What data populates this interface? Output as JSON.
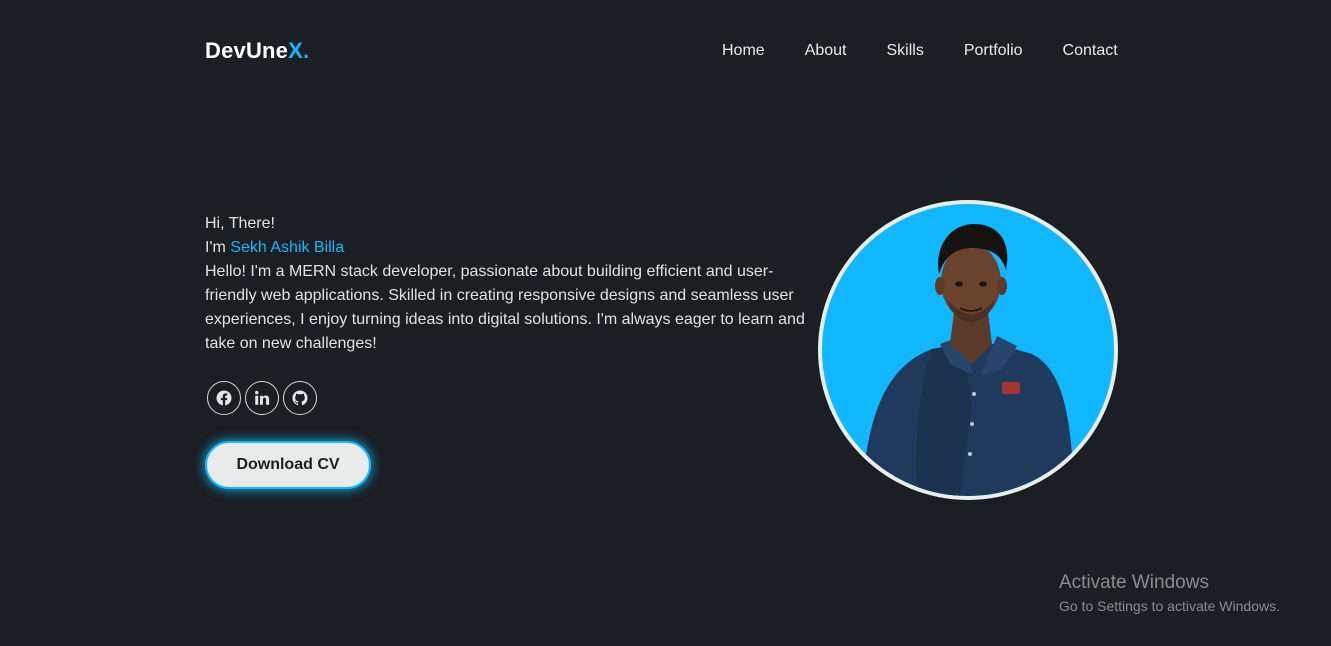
{
  "header": {
    "logo_main": "DevUne",
    "logo_accent": "X.",
    "nav": [
      {
        "label": "Home"
      },
      {
        "label": "About"
      },
      {
        "label": "Skills"
      },
      {
        "label": "Portfolio"
      },
      {
        "label": "Contact"
      }
    ]
  },
  "hero": {
    "greeting": "Hi, There!",
    "im_prefix": "I'm ",
    "name": "Sekh Ashik Billa",
    "bio": "Hello! I'm a MERN stack developer, passionate about building efficient and user-friendly web applications. Skilled in creating responsive designs and seamless user experiences, I enjoy turning ideas into digital solutions. I'm always eager to learn and take on new challenges!",
    "socials": [
      {
        "icon": "facebook-icon"
      },
      {
        "icon": "linkedin-icon"
      },
      {
        "icon": "github-icon"
      }
    ],
    "cv_button": "Download CV"
  },
  "watermark": {
    "title": "Activate Windows",
    "subtitle": "Go to Settings to activate Windows."
  },
  "colors": {
    "background": "#1b1e22",
    "accent": "#12b8ff",
    "button_bg": "#e9ebeb"
  }
}
